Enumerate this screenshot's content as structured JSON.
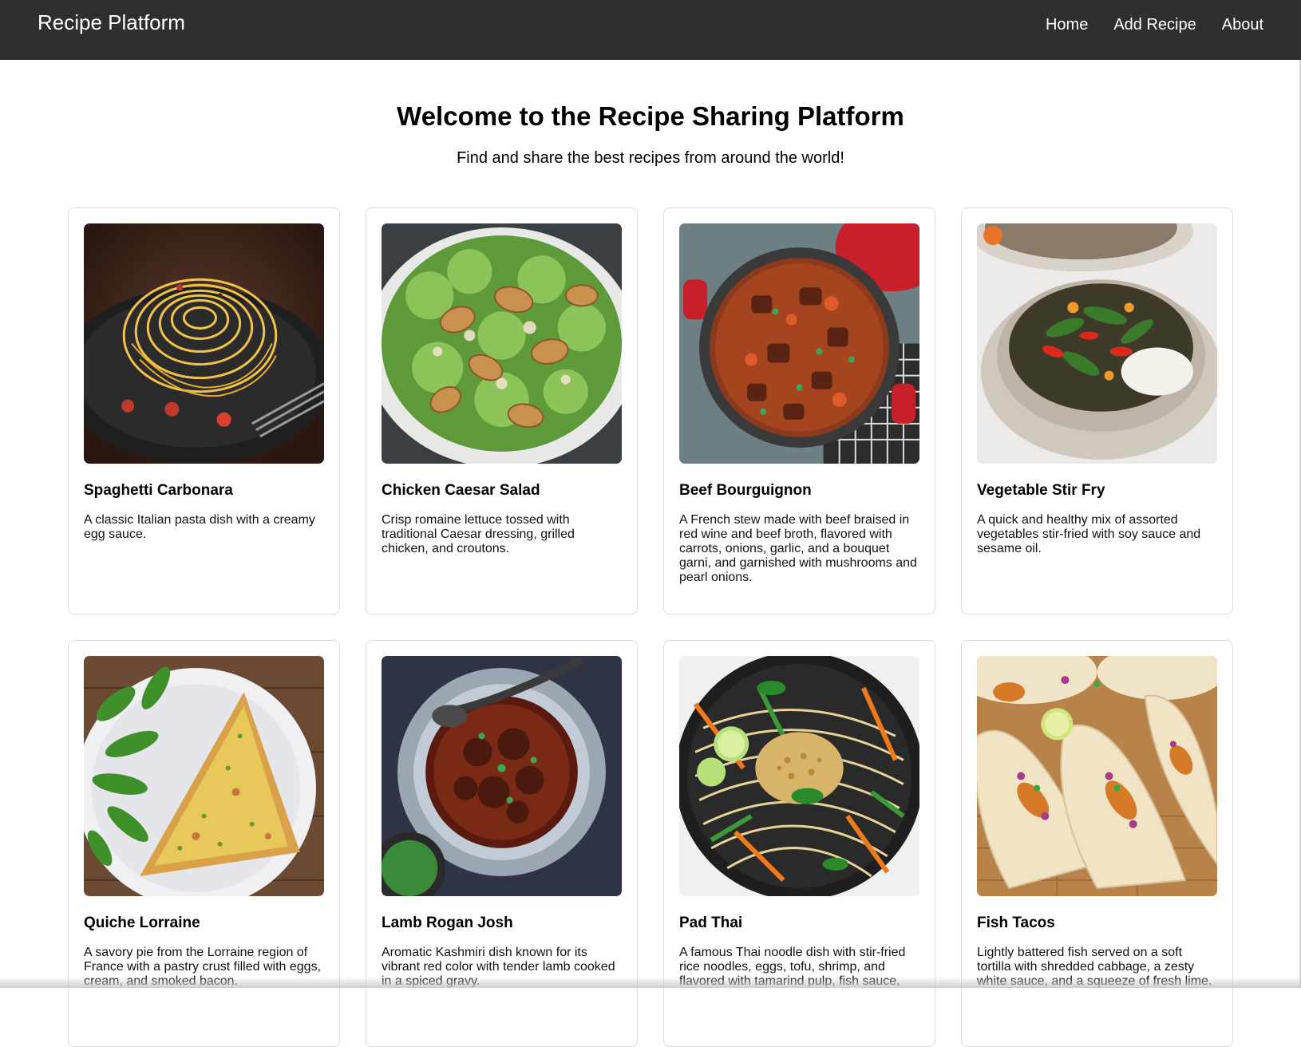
{
  "navbar": {
    "brand": "Recipe Platform",
    "links": [
      "Home",
      "Add Recipe",
      "About"
    ]
  },
  "hero": {
    "title": "Welcome to the Recipe Sharing Platform",
    "subtitle": "Find and share the best recipes from around the world!"
  },
  "recipes": [
    {
      "name": "Spaghetti Carbonara",
      "description": "A classic Italian pasta dish with a creamy egg sauce.",
      "image": "spaghetti-carbonara-photo"
    },
    {
      "name": "Chicken Caesar Salad",
      "description": "Crisp romaine lettuce tossed with traditional Caesar dressing, grilled chicken, and croutons.",
      "image": "chicken-caesar-salad-photo"
    },
    {
      "name": "Beef Bourguignon",
      "description": "A French stew made with beef braised in red wine and beef broth, flavored with carrots, onions, garlic, and a bouquet garni, and garnished with mushrooms and pearl onions.",
      "image": "beef-bourguignon-photo"
    },
    {
      "name": "Vegetable Stir Fry",
      "description": "A quick and healthy mix of assorted vegetables stir-fried with soy sauce and sesame oil.",
      "image": "vegetable-stir-fry-photo"
    },
    {
      "name": "Quiche Lorraine",
      "description": "A savory pie from the Lorraine region of France with a pastry crust filled with eggs, cream, and smoked bacon.",
      "image": "quiche-lorraine-photo"
    },
    {
      "name": "Lamb Rogan Josh",
      "description": "Aromatic Kashmiri dish known for its vibrant red color with tender lamb cooked in a spiced gravy.",
      "image": "lamb-rogan-josh-photo"
    },
    {
      "name": "Pad Thai",
      "description": "A famous Thai noodle dish with stir-fried rice noodles, eggs, tofu, shrimp, and flavored with tamarind pulp, fish sauce,",
      "image": "pad-thai-photo"
    },
    {
      "name": "Fish Tacos",
      "description": "Lightly battered fish served on a soft tortilla with shredded cabbage, a zesty white sauce, and a squeeze of fresh lime.",
      "image": "fish-tacos-photo"
    }
  ],
  "colors": {
    "navbar_bg": "#2f2f2f",
    "card_border": "#dcdcdc",
    "text": "#000000"
  }
}
